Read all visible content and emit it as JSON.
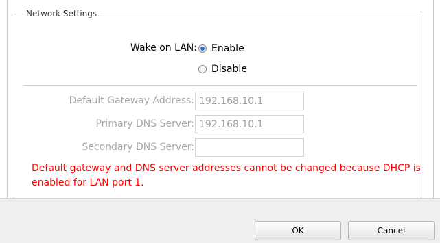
{
  "section": {
    "legend": "Network Settings"
  },
  "wake_on_lan": {
    "label": "Wake on LAN:",
    "options": [
      {
        "label": "Enable",
        "selected": true
      },
      {
        "label": "Disable",
        "selected": false
      }
    ]
  },
  "fields": {
    "gateway": {
      "label": "Default Gateway Address:",
      "value": "192.168.10.1"
    },
    "primary_dns": {
      "label": "Primary DNS Server:",
      "value": "192.168.10.1"
    },
    "secondary_dns": {
      "label": "Secondary DNS Server:",
      "value": ""
    }
  },
  "warning": {
    "text": "Default gateway and DNS server addresses cannot be changed because DHCP is enabled for LAN port 1."
  },
  "buttons": {
    "ok": "OK",
    "cancel": "Cancel"
  },
  "colors": {
    "warning": "#ff0000",
    "accent": "#2b6fd6",
    "disabled_text": "#a8a8a8"
  }
}
